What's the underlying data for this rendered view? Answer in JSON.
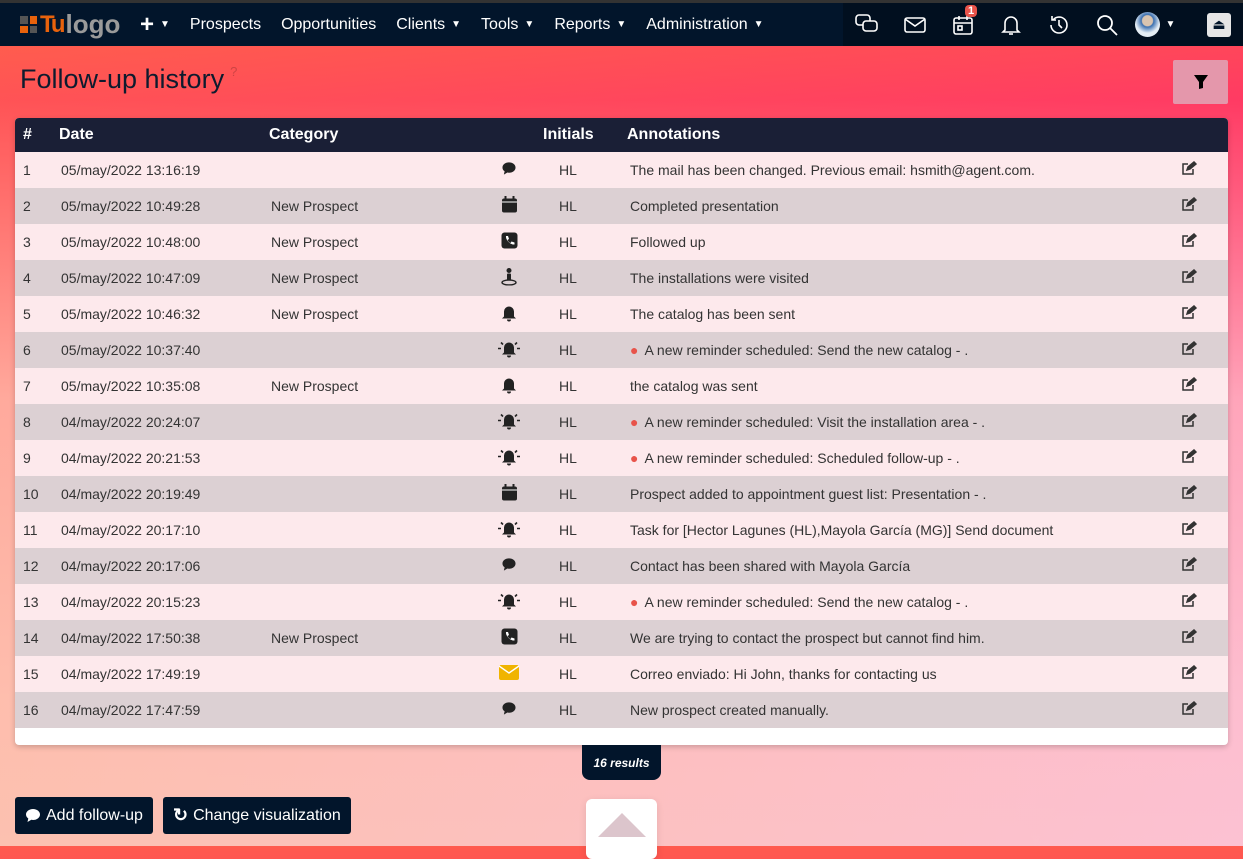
{
  "nav": {
    "logo_tu": "Tu",
    "logo_text": "logo",
    "plus": "+",
    "items": [
      "Prospects",
      "Opportunities",
      "Clients",
      "Tools",
      "Reports",
      "Administration"
    ],
    "has_dropdown": [
      false,
      false,
      true,
      true,
      true,
      true
    ],
    "calendar_badge": "1"
  },
  "page": {
    "title": "Follow-up history",
    "help": "?"
  },
  "table": {
    "headers": [
      "#",
      "Date",
      "Category",
      "",
      "Initials",
      "Annotations"
    ],
    "rows": [
      {
        "n": "1",
        "date": "05/may/2022 13:16:19",
        "category": "",
        "icon": "comment",
        "initials": "HL",
        "annotation": "The mail has been changed. Previous email: hsmith@agent.com.",
        "pin": false
      },
      {
        "n": "2",
        "date": "05/may/2022 10:49:28",
        "category": "New Prospect",
        "icon": "calendar",
        "initials": "HL",
        "annotation": "Completed presentation",
        "pin": false
      },
      {
        "n": "3",
        "date": "05/may/2022 10:48:00",
        "category": "New Prospect",
        "icon": "phone",
        "initials": "HL",
        "annotation": "Followed up",
        "pin": false
      },
      {
        "n": "4",
        "date": "05/may/2022 10:47:09",
        "category": "New Prospect",
        "icon": "visit",
        "initials": "HL",
        "annotation": "The installations were visited",
        "pin": false
      },
      {
        "n": "5",
        "date": "05/may/2022 10:46:32",
        "category": "New Prospect",
        "icon": "bell",
        "initials": "HL",
        "annotation": "The catalog has been sent",
        "pin": false
      },
      {
        "n": "6",
        "date": "05/may/2022 10:37:40",
        "category": "",
        "icon": "alarm",
        "initials": "HL",
        "annotation": "A new reminder scheduled: Send the new catalog - .",
        "pin": true
      },
      {
        "n": "7",
        "date": "05/may/2022 10:35:08",
        "category": "New Prospect",
        "icon": "bell",
        "initials": "HL",
        "annotation": "the catalog was sent",
        "pin": false
      },
      {
        "n": "8",
        "date": "04/may/2022 20:24:07",
        "category": "",
        "icon": "alarm",
        "initials": "HL",
        "annotation": "A new reminder scheduled: Visit the installation area - .",
        "pin": true
      },
      {
        "n": "9",
        "date": "04/may/2022 20:21:53",
        "category": "",
        "icon": "alarm",
        "initials": "HL",
        "annotation": "A new reminder scheduled: Scheduled follow-up - .",
        "pin": true
      },
      {
        "n": "10",
        "date": "04/may/2022 20:19:49",
        "category": "",
        "icon": "calendar",
        "initials": "HL",
        "annotation": "Prospect added to appointment guest list: Presentation - .",
        "pin": false
      },
      {
        "n": "11",
        "date": "04/may/2022 20:17:10",
        "category": "",
        "icon": "alarm",
        "initials": "HL",
        "annotation": "Task for [Hector Lagunes (HL),Mayola García (MG)] Send document",
        "pin": false
      },
      {
        "n": "12",
        "date": "04/may/2022 20:17:06",
        "category": "",
        "icon": "comment",
        "initials": "HL",
        "annotation": "Contact has been shared with Mayola García",
        "pin": false
      },
      {
        "n": "13",
        "date": "04/may/2022 20:15:23",
        "category": "",
        "icon": "alarm",
        "initials": "HL",
        "annotation": "A new reminder scheduled: Send the new catalog - .",
        "pin": true
      },
      {
        "n": "14",
        "date": "04/may/2022 17:50:38",
        "category": "New Prospect",
        "icon": "phone",
        "initials": "HL",
        "annotation": "We are trying to contact the prospect but cannot find him.",
        "pin": false
      },
      {
        "n": "15",
        "date": "04/may/2022 17:49:19",
        "category": "",
        "icon": "mail",
        "initials": "HL",
        "annotation": "Correo enviado: Hi John, thanks for contacting us",
        "pin": false
      },
      {
        "n": "16",
        "date": "04/may/2022 17:47:59",
        "category": "",
        "icon": "comment",
        "initials": "HL",
        "annotation": "New prospect created manually.",
        "pin": false
      }
    ]
  },
  "results": "16 results",
  "buttons": {
    "add": "Add follow-up",
    "change": "Change visualization"
  },
  "colors": {
    "nav": "#02152b",
    "mail_icon": "#f0b400",
    "pin": "#e8534a"
  }
}
